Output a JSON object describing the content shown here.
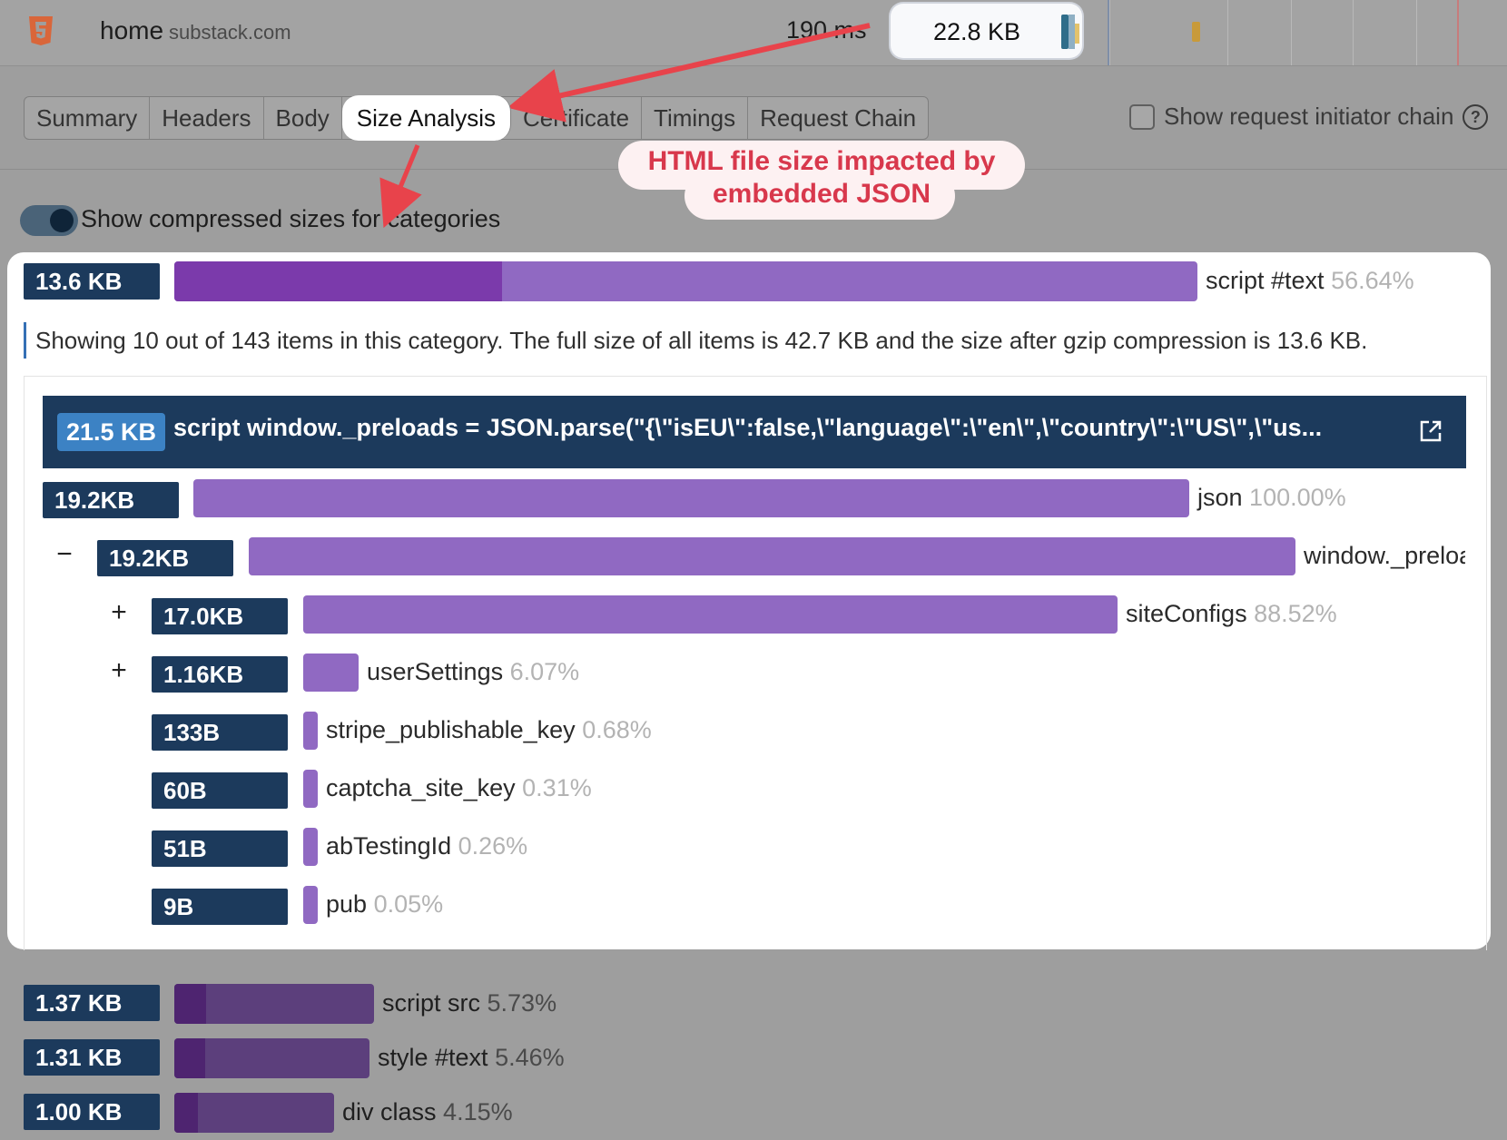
{
  "request": {
    "name": "home",
    "domain": "substack.com",
    "time": "190 ms",
    "size": "22.8 KB"
  },
  "tabs": [
    {
      "label": "Summary"
    },
    {
      "label": "Headers"
    },
    {
      "label": "Body"
    },
    {
      "label": "Size Analysis",
      "active": true
    },
    {
      "label": "Certificate"
    },
    {
      "label": "Timings"
    },
    {
      "label": "Request Chain"
    }
  ],
  "initiator_label": "Show request initiator chain",
  "toggle_label": "Show compressed sizes for categories",
  "annotation": "HTML file size impacted by embedded JSON",
  "category": {
    "size": "13.6 KB",
    "label": "script #text",
    "percent": "56.64%",
    "compressed_fraction": 0.32,
    "info": "Showing 10 out of 143 items in this category. The full size of all items is 42.7 KB and the size after gzip compression is 13.6 KB."
  },
  "item": {
    "size": "21.5 KB",
    "title": "script window._preloads = JSON.parse(\"{\\\"isEU\\\":false,\\\"language\\\":\\\"en\\\",\\\"country\\\":\\\"US\\\",\\\"us..."
  },
  "tree": [
    {
      "size": "19.2KB",
      "label": "json",
      "percent": "100.00%",
      "fraction": 1.0
    },
    {
      "size": "19.2KB",
      "label": "window._preloa",
      "percent": "",
      "fraction": 1.0,
      "expander": "−"
    },
    {
      "size": "17.0KB",
      "label": "siteConfigs",
      "percent": "88.52%",
      "fraction": 0.8852,
      "expander": "+"
    },
    {
      "size": "1.16KB",
      "label": "userSettings",
      "percent": "6.07%",
      "fraction": 0.0607,
      "expander": "+"
    },
    {
      "size": "133B",
      "label": "stripe_publishable_key",
      "percent": "0.68%",
      "fraction": 0.0068
    },
    {
      "size": "60B",
      "label": "captcha_site_key",
      "percent": "0.31%",
      "fraction": 0.0031
    },
    {
      "size": "51B",
      "label": "abTestingId",
      "percent": "0.26%",
      "fraction": 0.0026
    },
    {
      "size": "9B",
      "label": "pub",
      "percent": "0.05%",
      "fraction": 0.0005
    }
  ],
  "other_categories": [
    {
      "size": "1.37 KB",
      "label": "script src",
      "percent": "5.73%",
      "fraction": 0.1012,
      "compressed_fraction": 0.16
    },
    {
      "size": "1.31 KB",
      "label": "style #text",
      "percent": "5.46%",
      "fraction": 0.0964,
      "compressed_fraction": 0.16
    },
    {
      "size": "1.00 KB",
      "label": "div class",
      "percent": "4.15%",
      "fraction": 0.0733,
      "compressed_fraction": 0.15
    }
  ],
  "colors": {
    "badge": "#1c3a5c",
    "bar": "#9069c2",
    "bar_compressed": "#7b3aab",
    "annotation": "#d8384c"
  }
}
